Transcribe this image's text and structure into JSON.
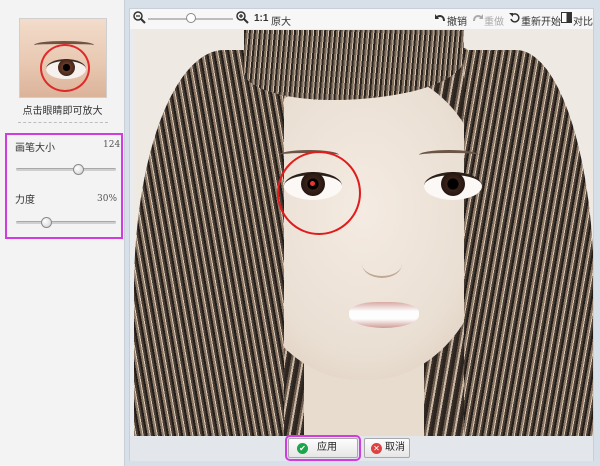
{
  "sidebar": {
    "thumb_caption": "点击眼睛即可放大",
    "brush_label": "画笔大小",
    "brush_value": "124",
    "brush_level": 0.62,
    "strength_label": "力度",
    "strength_value": "30%",
    "strength_level": 0.3
  },
  "toolbar": {
    "zoom_out_icon": "zoom-out-icon",
    "zoom_in_icon": "zoom-in-icon",
    "actual_size_prefix": "1:1",
    "actual_size_label": "原大",
    "undo_label": "撤销",
    "redo_label": "重做",
    "reset_label": "重新开始",
    "compare_label": "对比"
  },
  "actions": {
    "apply_label": "应用",
    "cancel_label": "取消"
  },
  "colors": {
    "highlight": "#d03ce0",
    "ring": "#e01c1c",
    "apply_icon": "#1aa64a",
    "cancel_icon": "#e04040"
  }
}
